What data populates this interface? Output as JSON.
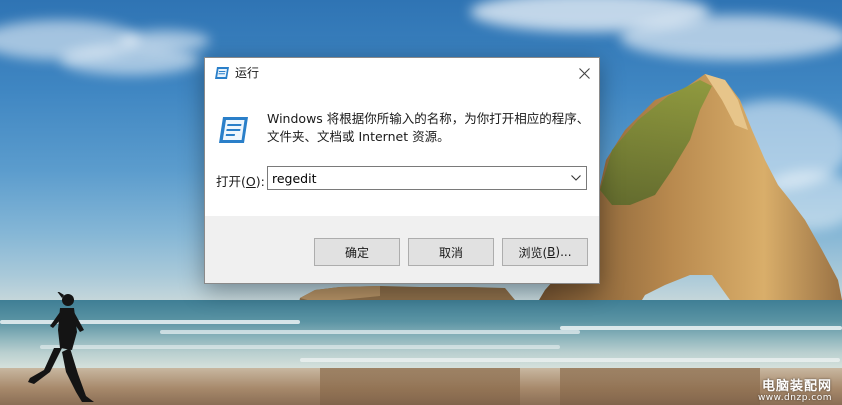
{
  "desktop": {
    "watermark_title": "电脑装配网",
    "watermark_url": "www.dnzp.com"
  },
  "run_dialog": {
    "title": "运行",
    "title_icon": "run-icon",
    "close_icon": "close-icon",
    "description_line1": "Windows 将根据你所输入的名称，为你打开相应的程序、",
    "description_line2": "文件夹、文档或 Internet 资源。",
    "open_label_prefix": "打开(",
    "open_label_key": "O",
    "open_label_suffix": "):",
    "input_value": "regedit",
    "dropdown_icon": "chevron-down-icon",
    "buttons": {
      "ok": "确定",
      "cancel": "取消",
      "browse_prefix": "浏览(",
      "browse_key": "B",
      "browse_suffix": ")..."
    },
    "colors": {
      "accent": "#1e6fb8",
      "button_face": "#e1e1e1",
      "button_area": "#f0f0f0"
    }
  }
}
